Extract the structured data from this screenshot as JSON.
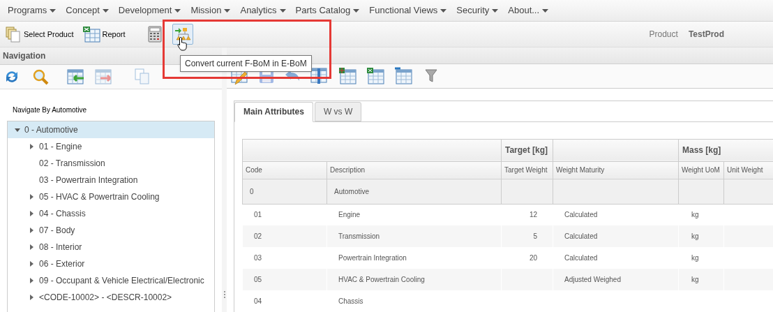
{
  "menu": [
    {
      "label": "Programs"
    },
    {
      "label": "Concept"
    },
    {
      "label": "Development"
    },
    {
      "label": "Mission"
    },
    {
      "label": "Analytics"
    },
    {
      "label": "Parts Catalog"
    },
    {
      "label": "Functional Views"
    },
    {
      "label": "Security"
    },
    {
      "label": "About..."
    }
  ],
  "toolbar": [
    {
      "kind": "select",
      "label": "Select Product",
      "hovered": false
    },
    {
      "kind": "report",
      "label": "Report",
      "hovered": false
    },
    {
      "kind": "calculator",
      "hovered": false
    },
    {
      "kind": "convert",
      "hovered": true
    }
  ],
  "product": {
    "label": "Product",
    "value": "TestProd"
  },
  "tooltip": "Convert current F-BoM in E-BoM",
  "navigation": {
    "title": "Navigation",
    "caption": "Navigate By Automotive",
    "tree": [
      {
        "label": "0 - Automotive",
        "selected": true,
        "expanded": true,
        "has_children": true,
        "children": [
          {
            "label": "01 - Engine",
            "selected": false,
            "expanded": false,
            "has_children": true
          },
          {
            "label": "02 - Transmission",
            "selected": false,
            "expanded": false,
            "has_children": false
          },
          {
            "label": "03 - Powertrain Integration",
            "selected": false,
            "expanded": false,
            "has_children": false
          },
          {
            "label": "05 - HVAC & Powertrain Cooling",
            "selected": false,
            "expanded": false,
            "has_children": true
          },
          {
            "label": "04 - Chassis",
            "selected": false,
            "expanded": false,
            "has_children": true
          },
          {
            "label": "07 - Body",
            "selected": false,
            "expanded": false,
            "has_children": true
          },
          {
            "label": "08 - Interior",
            "selected": false,
            "expanded": false,
            "has_children": true
          },
          {
            "label": "06 - Exterior",
            "selected": false,
            "expanded": false,
            "has_children": true
          },
          {
            "label": "09 - Occupant & Vehicle Electrical/Electronic",
            "selected": false,
            "expanded": false,
            "has_children": true
          },
          {
            "label": "<CODE-10002> - <DESCR-10002>",
            "selected": false,
            "expanded": false,
            "has_children": true
          }
        ]
      }
    ]
  },
  "detail": {
    "tabs": [
      {
        "label": "Main Attributes",
        "selected": true
      },
      {
        "label": "W vs W",
        "selected": false
      }
    ],
    "table": {
      "column_groups": [
        {
          "columns": [
            {
              "label": "Code"
            },
            {
              "label": "Description"
            }
          ]
        },
        {
          "label": "Target [kg]",
          "columns": [
            {
              "label": "Target Weight"
            }
          ]
        },
        {
          "columns": [
            {
              "label": "Weight Maturity"
            }
          ]
        },
        {
          "label": "Mass [kg]",
          "columns": [
            {
              "label": "Weight UoM"
            },
            {
              "label": "Unit Weight"
            }
          ]
        }
      ],
      "rows": [
        {
          "kind": "root",
          "code": "0",
          "description": "Automotive"
        },
        {
          "kind": "item",
          "code": "01",
          "description": "Engine",
          "target_weight": "12",
          "weight_maturity": "Calculated",
          "weight_uom": "kg"
        },
        {
          "kind": "item",
          "code": "02",
          "description": "Transmission",
          "target_weight": "5",
          "weight_maturity": "Calculated",
          "weight_uom": "kg"
        },
        {
          "kind": "item",
          "code": "03",
          "description": "Powertrain Integration",
          "target_weight": "20",
          "weight_maturity": "Calculated",
          "weight_uom": "kg"
        },
        {
          "kind": "item",
          "code": "05",
          "description": "HVAC & Powertrain Cooling",
          "weight_maturity": "Adjusted Weighed",
          "weight_uom": "kg"
        },
        {
          "kind": "item",
          "code": "04",
          "description": "Chassis"
        }
      ]
    }
  }
}
